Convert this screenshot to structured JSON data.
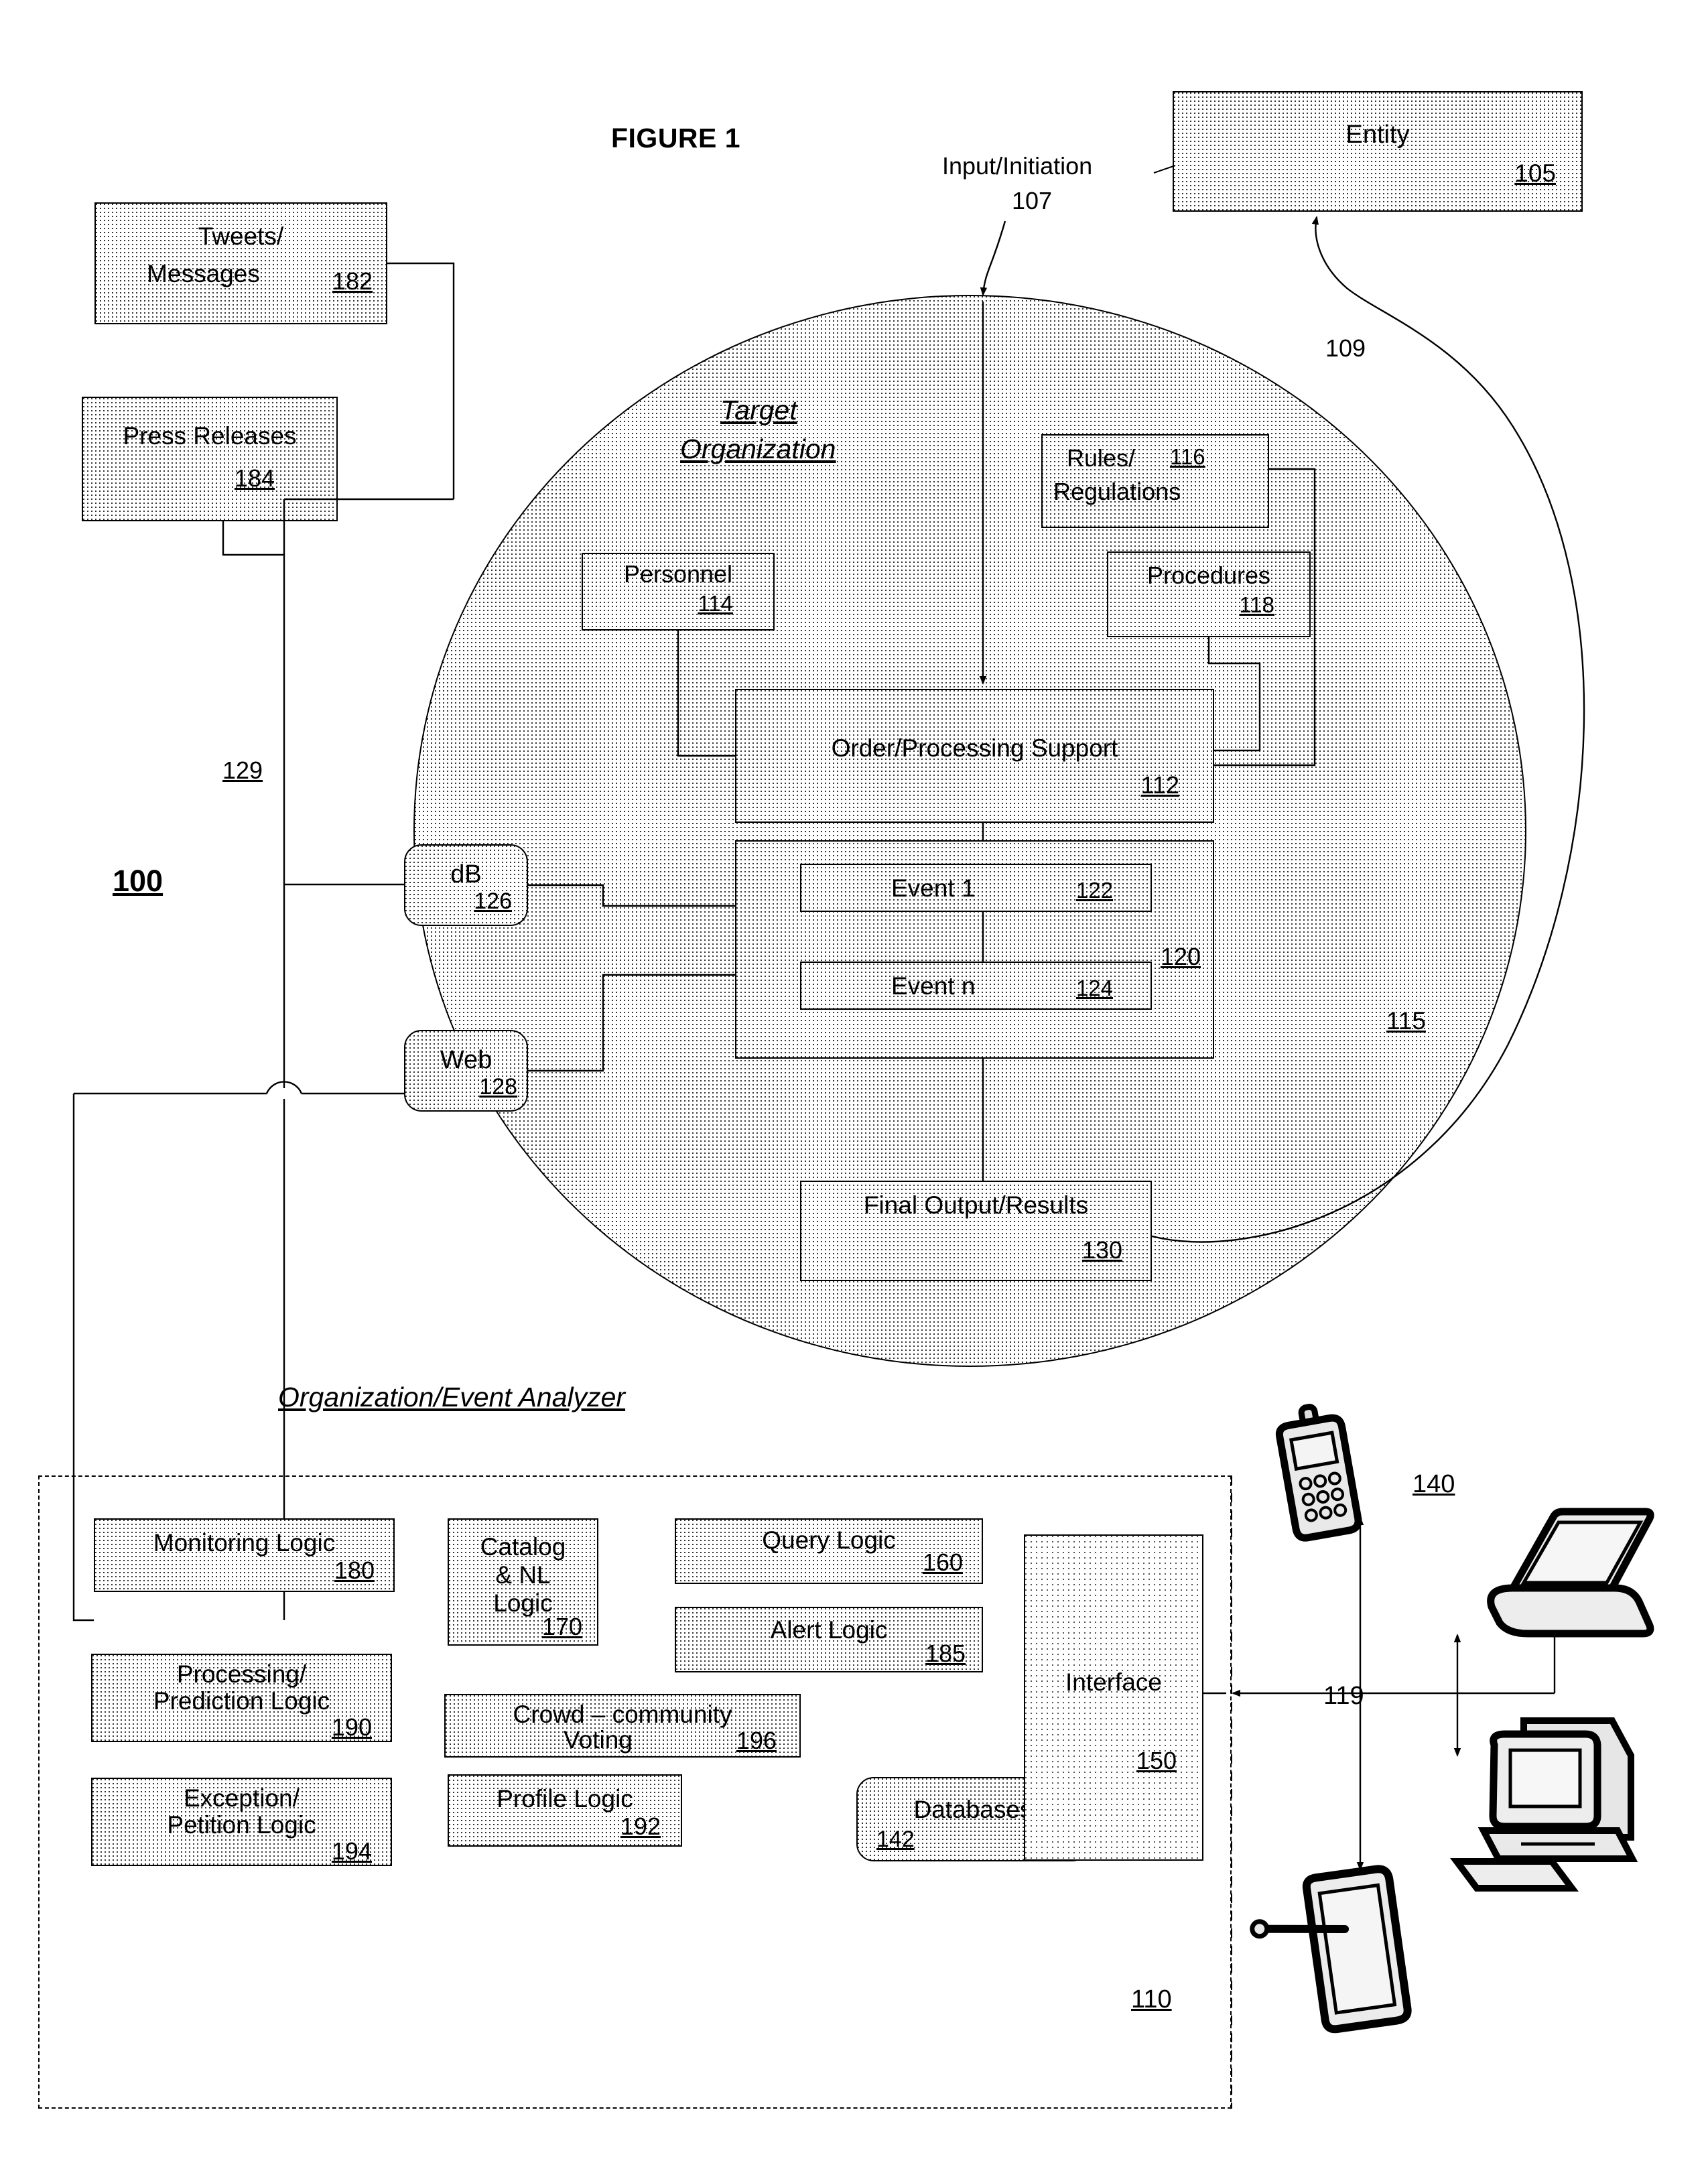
{
  "figure": {
    "title": "FIGURE 1",
    "system_ref": "100"
  },
  "entity": {
    "label": "Entity",
    "ref": "105"
  },
  "input": {
    "label": "Input/Initiation",
    "ref": "107"
  },
  "feedback": {
    "ref": "109"
  },
  "sources": [
    {
      "name": "tweets-messages",
      "line1": "Tweets/",
      "line2": "Messages",
      "ref": "182"
    },
    {
      "name": "press-releases",
      "line1": "Press Releases",
      "line2": "",
      "ref": "184"
    }
  ],
  "bus": {
    "ref": "129"
  },
  "target_org": {
    "title_line1": "Target",
    "title_line2": "Organization",
    "ref": "115",
    "nodes": [
      {
        "name": "rules-regulations",
        "line1": "Rules/",
        "line2": "Regulations",
        "ref": "116"
      },
      {
        "name": "procedures",
        "line1": "Procedures",
        "line2": "",
        "ref": "118"
      },
      {
        "name": "personnel",
        "line1": "Personnel",
        "line2": "",
        "ref": "114"
      },
      {
        "name": "order-processing-support",
        "line1": "Order/Processing Support",
        "line2": "",
        "ref": "112"
      },
      {
        "name": "events-group",
        "line1": "",
        "line2": "",
        "ref": "120"
      },
      {
        "name": "event-1",
        "line1": "Event 1",
        "line2": "",
        "ref": "122"
      },
      {
        "name": "event-n",
        "line1": "Event n",
        "line2": "",
        "ref": "124"
      },
      {
        "name": "final-output-results",
        "line1": "Final Output/Results",
        "line2": "",
        "ref": "130"
      }
    ]
  },
  "channels": [
    {
      "name": "db",
      "label": "dB",
      "ref": "126"
    },
    {
      "name": "web",
      "label": "Web",
      "ref": "128"
    }
  ],
  "analyzer": {
    "title": "Organization/Event Analyzer",
    "ref": "110",
    "modules": [
      {
        "name": "monitoring-logic",
        "line1": "Monitoring Logic",
        "line2": "",
        "ref": "180"
      },
      {
        "name": "processing-prediction-logic",
        "line1": "Processing/",
        "line2": "Prediction Logic",
        "ref": "190"
      },
      {
        "name": "exception-petition-logic",
        "line1": "Exception/",
        "line2": "Petition Logic",
        "ref": "194"
      },
      {
        "name": "catalog-nl-logic",
        "line1": "Catalog",
        "line2": "& NL",
        "line3": "Logic",
        "ref": "170"
      },
      {
        "name": "crowd-community-voting",
        "line1": "Crowd – community",
        "line2": "Voting",
        "ref": "196"
      },
      {
        "name": "profile-logic",
        "line1": "Profile Logic",
        "line2": "",
        "ref": "192"
      },
      {
        "name": "query-logic",
        "line1": "Query Logic",
        "line2": "",
        "ref": "160"
      },
      {
        "name": "alert-logic",
        "line1": "Alert Logic",
        "line2": "",
        "ref": "185"
      },
      {
        "name": "databases",
        "line1": "Databases",
        "line2": "",
        "ref": "142"
      },
      {
        "name": "interface",
        "line1": "Interface",
        "line2": "",
        "ref": "150"
      }
    ]
  },
  "devices": {
    "ref": "140",
    "link_ref": "119",
    "items": [
      {
        "name": "mobile-phone-icon"
      },
      {
        "name": "laptop-icon"
      },
      {
        "name": "desktop-computer-icon"
      },
      {
        "name": "tablet-stylus-icon"
      }
    ]
  }
}
